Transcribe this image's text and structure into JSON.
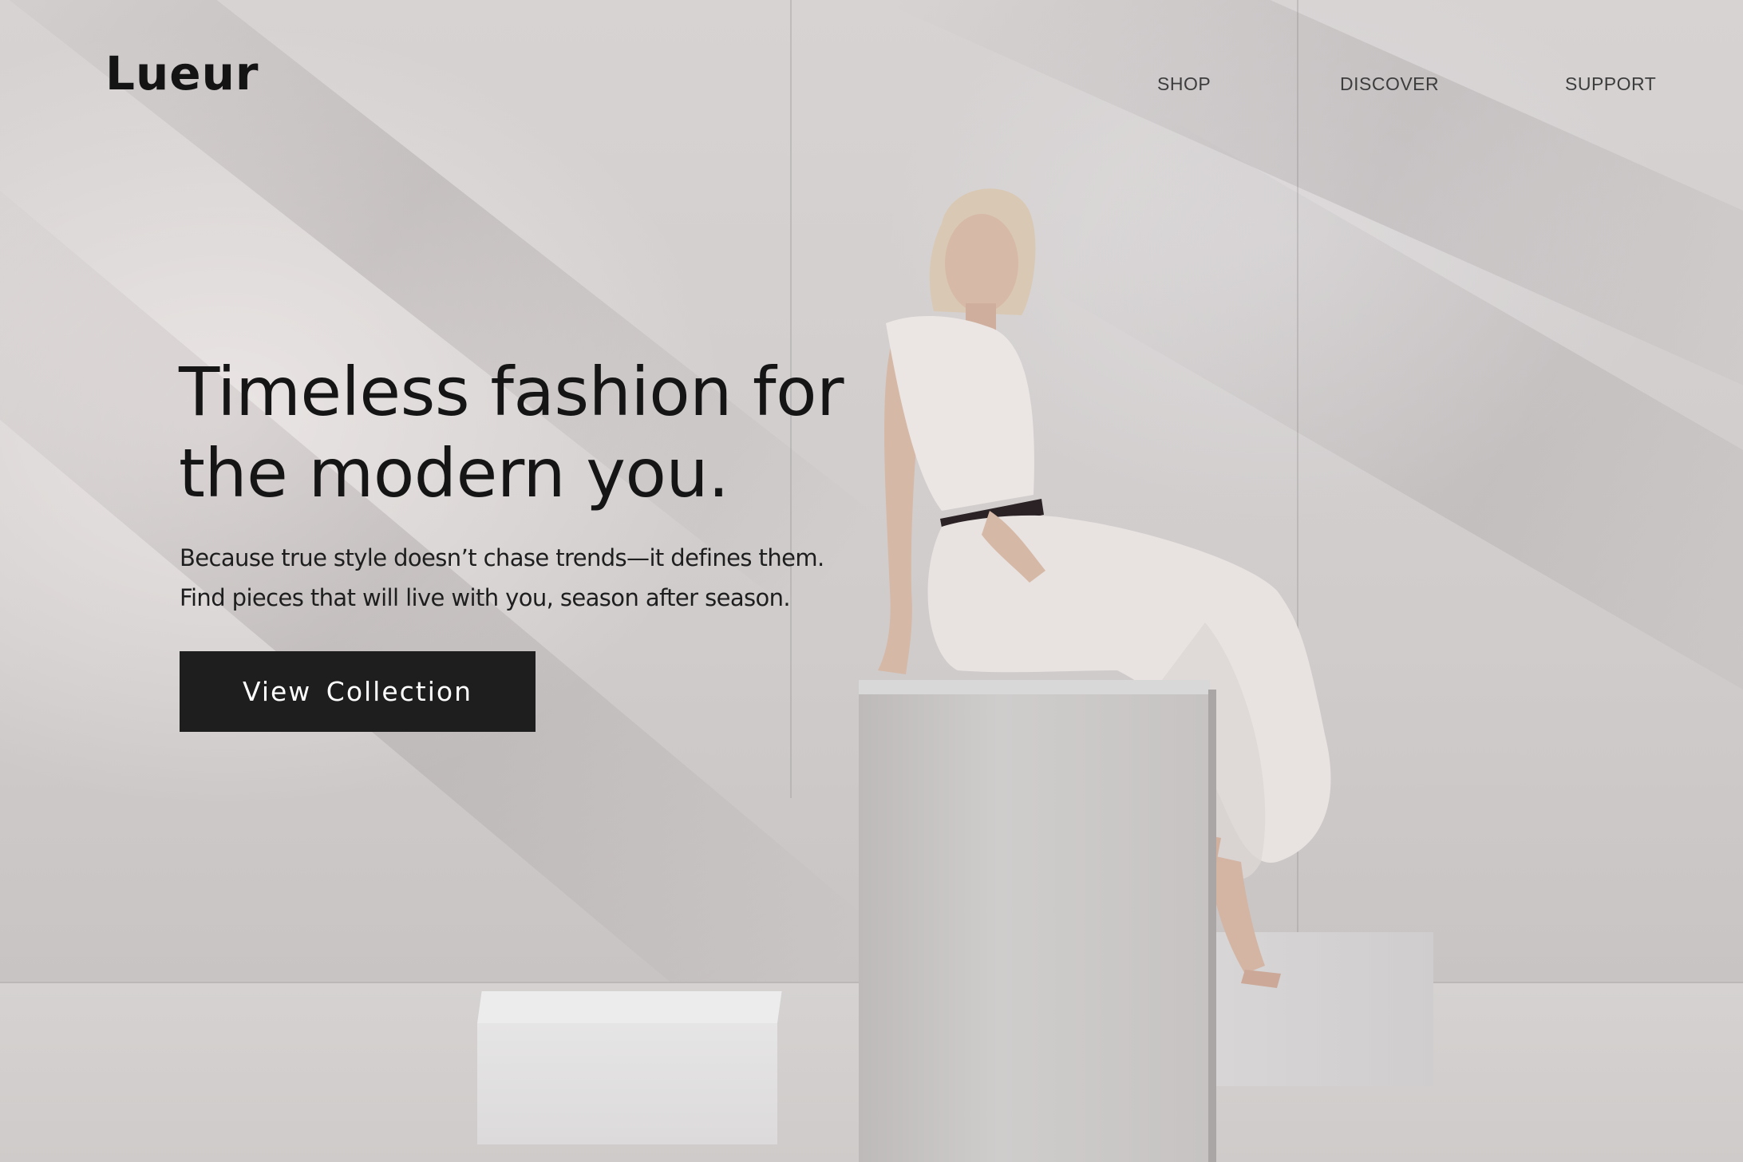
{
  "header": {
    "logo": "Lueur",
    "nav": [
      {
        "label": "SHOP"
      },
      {
        "label": "DISCOVER"
      },
      {
        "label": "SUPPORT"
      }
    ]
  },
  "hero": {
    "headline_lines": [
      "Timeless fashion for",
      "the modern you."
    ],
    "subtext_lines": [
      "Because true style doesn’t chase trends—it defines them.",
      "Find pieces that will live with you, season after season."
    ],
    "cta_label": "View  Collection",
    "image_semantic": "model-seated-on-pedestal-photo"
  },
  "colors": {
    "text": "#151515",
    "button_bg": "#1e1e1f",
    "button_text": "#ffffff",
    "nav_text": "#3d3d3d"
  }
}
